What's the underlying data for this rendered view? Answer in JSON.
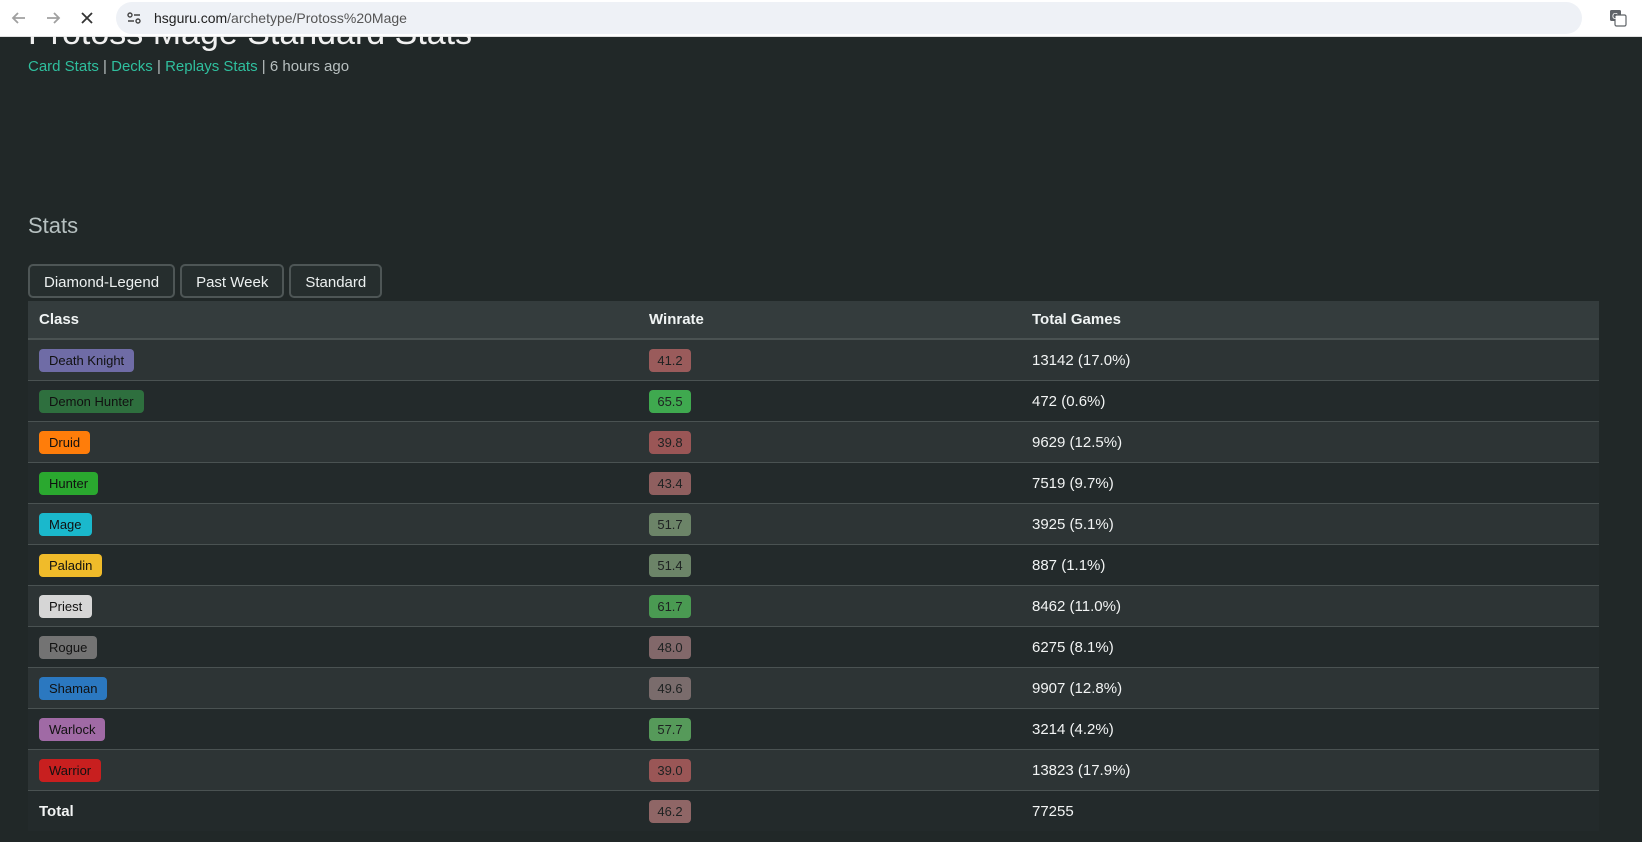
{
  "browser": {
    "url_host": "hsguru.com",
    "url_path": "/archetype/Protoss%20Mage"
  },
  "page": {
    "title": "Protoss Mage Standard Stats",
    "links": [
      "Card Stats",
      "Decks",
      "Replays Stats"
    ],
    "updated": "6 hours ago",
    "stats_heading": "Stats"
  },
  "filters": [
    "Diamond-Legend",
    "Past Week",
    "Standard"
  ],
  "table": {
    "headers": [
      "Class",
      "Winrate",
      "Total Games"
    ],
    "rows": [
      {
        "class": "Death Knight",
        "color": "#6f6ca6",
        "text_color": "#111111",
        "winrate": "41.2",
        "wr_color": "#9a5b5b",
        "games": "13142 (17.0%)"
      },
      {
        "class": "Demon Hunter",
        "color": "#2e6f3e",
        "text_color": "#111111",
        "winrate": "65.5",
        "wr_color": "#3fa94f",
        "games": "472 (0.6%)"
      },
      {
        "class": "Druid",
        "color": "#ff7d0a",
        "text_color": "#111111",
        "winrate": "39.8",
        "wr_color": "#9a5656",
        "games": "9629 (12.5%)"
      },
      {
        "class": "Hunter",
        "color": "#2aa82f",
        "text_color": "#111111",
        "winrate": "43.4",
        "wr_color": "#8f5f5f",
        "games": "7519 (9.7%)"
      },
      {
        "class": "Mage",
        "color": "#1ab8cc",
        "text_color": "#111111",
        "winrate": "51.7",
        "wr_color": "#6c8468",
        "games": "3925 (5.1%)"
      },
      {
        "class": "Paladin",
        "color": "#f0bb2a",
        "text_color": "#111111",
        "winrate": "51.4",
        "wr_color": "#6c8468",
        "games": "887 (1.1%)"
      },
      {
        "class": "Priest",
        "color": "#d6d6d6",
        "text_color": "#111111",
        "winrate": "61.7",
        "wr_color": "#4a9a52",
        "games": "8462 (11.0%)"
      },
      {
        "class": "Rogue",
        "color": "#737373",
        "text_color": "#111111",
        "winrate": "48.0",
        "wr_color": "#82686a",
        "games": "6275 (8.1%)"
      },
      {
        "class": "Shaman",
        "color": "#2b78c0",
        "text_color": "#111111",
        "winrate": "49.6",
        "wr_color": "#7a6c6c",
        "games": "9907 (12.8%)"
      },
      {
        "class": "Warlock",
        "color": "#a06aa5",
        "text_color": "#111111",
        "winrate": "57.7",
        "wr_color": "#569a5a",
        "games": "3214 (4.2%)"
      },
      {
        "class": "Warrior",
        "color": "#c81f1f",
        "text_color": "#111111",
        "winrate": "39.0",
        "wr_color": "#9a5656",
        "games": "13823 (17.9%)"
      }
    ],
    "total": {
      "label": "Total",
      "winrate": "46.2",
      "wr_color": "#8f6666",
      "games": "77255"
    }
  }
}
